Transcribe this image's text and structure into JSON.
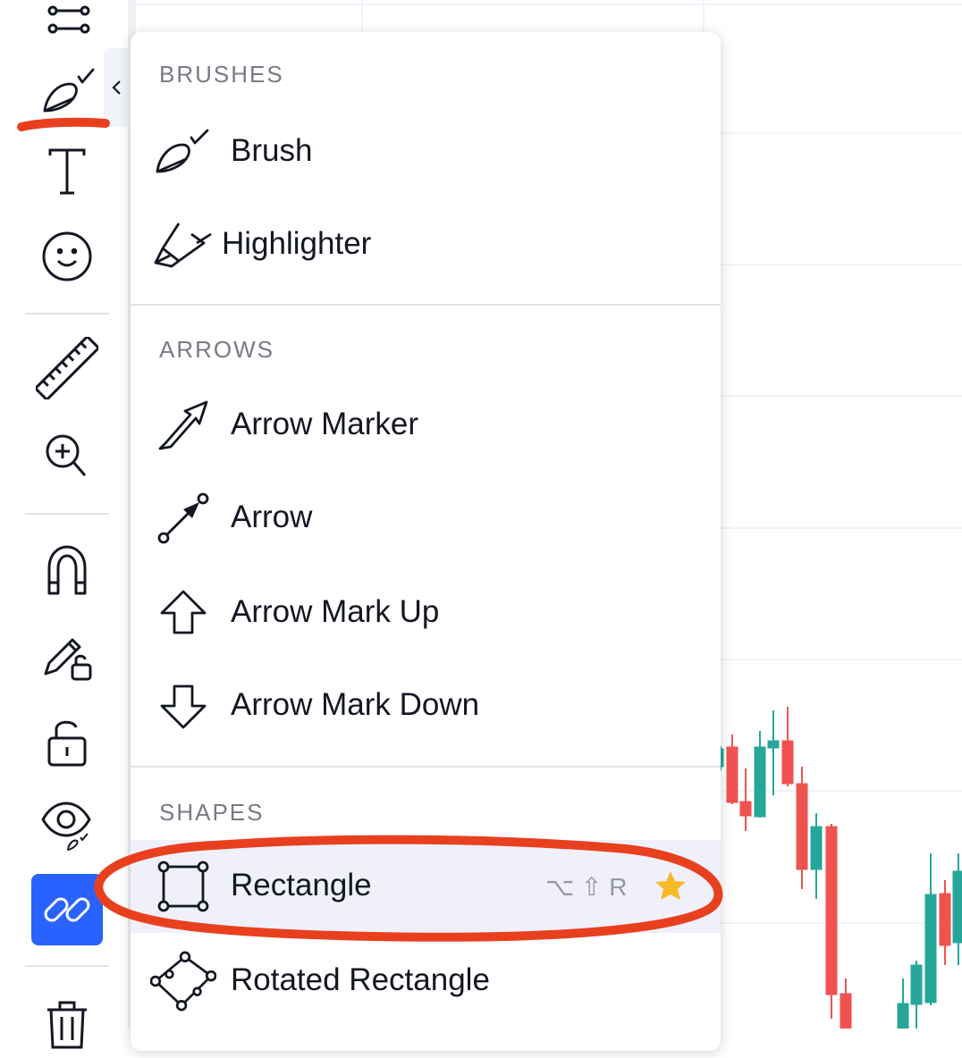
{
  "toolbar": {
    "tools": [
      {
        "icon": "trend-lines-icon"
      },
      {
        "icon": "brush-icon",
        "active": true
      },
      {
        "icon": "text-icon"
      },
      {
        "icon": "emoji-icon"
      },
      {
        "icon": "ruler-icon"
      },
      {
        "icon": "zoom-in-icon"
      },
      {
        "icon": "magnet-icon"
      },
      {
        "icon": "pencil-lock-icon"
      },
      {
        "icon": "lock-icon"
      },
      {
        "icon": "eye-icon"
      },
      {
        "icon": "link-icon",
        "highlighted": true
      },
      {
        "icon": "trash-icon"
      }
    ],
    "collapse_icon": "chevron-left-icon"
  },
  "menu": {
    "sections": [
      {
        "title": "BRUSHES",
        "items": [
          {
            "label": "Brush",
            "icon": "brush-icon"
          },
          {
            "label": "Highlighter",
            "icon": "highlighter-icon"
          }
        ]
      },
      {
        "title": "ARROWS",
        "items": [
          {
            "label": "Arrow Marker",
            "icon": "arrow-marker-icon"
          },
          {
            "label": "Arrow",
            "icon": "arrow-icon"
          },
          {
            "label": "Arrow Mark Up",
            "icon": "arrow-mark-up-icon"
          },
          {
            "label": "Arrow Mark Down",
            "icon": "arrow-mark-down-icon"
          }
        ]
      },
      {
        "title": "SHAPES",
        "items": [
          {
            "label": "Rectangle",
            "icon": "rectangle-icon",
            "hotkey": "⌥ ⇧ R",
            "favorite": true,
            "selected": true
          },
          {
            "label": "Rotated Rectangle",
            "icon": "rotated-rectangle-icon"
          }
        ]
      }
    ]
  },
  "colors": {
    "accent": "#2962ff",
    "candle_up": "#26a69a",
    "candle_down": "#ef5350",
    "favorite_star": "#f7b928",
    "annotation": "#e8401f"
  }
}
